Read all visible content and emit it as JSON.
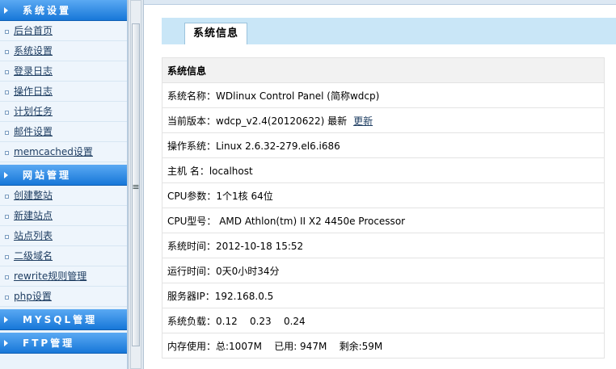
{
  "sidebar": {
    "sections": [
      {
        "title": "系统设置",
        "items": [
          {
            "label": "后台首页"
          },
          {
            "label": "系统设置"
          },
          {
            "label": "登录日志"
          },
          {
            "label": "操作日志"
          },
          {
            "label": "计划任务"
          },
          {
            "label": "邮件设置"
          },
          {
            "label": "memcached设置"
          }
        ]
      },
      {
        "title": "网站管理",
        "items": [
          {
            "label": "创建整站"
          },
          {
            "label": "新建站点"
          },
          {
            "label": "站点列表"
          },
          {
            "label": "二级域名"
          },
          {
            "label": "rewrite规则管理"
          },
          {
            "label": "php设置"
          }
        ]
      },
      {
        "title": "MYSQL管理",
        "items": []
      },
      {
        "title": "FTP管理",
        "items": []
      }
    ],
    "splitter_grip": "≡"
  },
  "main": {
    "tab_label": "系统信息",
    "table_header": "系统信息",
    "rows": [
      {
        "text": "系统名称：WDlinux Control Panel (简称wdcp)"
      },
      {
        "text": "当前版本：wdcp_v2.4(20120622) 最新",
        "link": "更新"
      },
      {
        "text": "操作系统：Linux 2.6.32-279.el6.i686"
      },
      {
        "text": "主机 名：localhost"
      },
      {
        "text": "CPU参数：1个1核 64位"
      },
      {
        "text": "CPU型号： AMD Athlon(tm) II X2 4450e Processor"
      },
      {
        "text": "系统时间：2012-10-18 15:52"
      },
      {
        "text": "运行时间：0天0小时34分"
      },
      {
        "text": "服务器IP：192.168.0.5"
      },
      {
        "text": "系统负载：0.12    0.23    0.24"
      },
      {
        "text": "内存使用：总:1007M    已用: 947M    剩余:59M"
      }
    ]
  },
  "colors": {
    "sidebar_header": "#1777d8",
    "tab_strip": "#c9e6f7",
    "link": "#1f3e62"
  }
}
